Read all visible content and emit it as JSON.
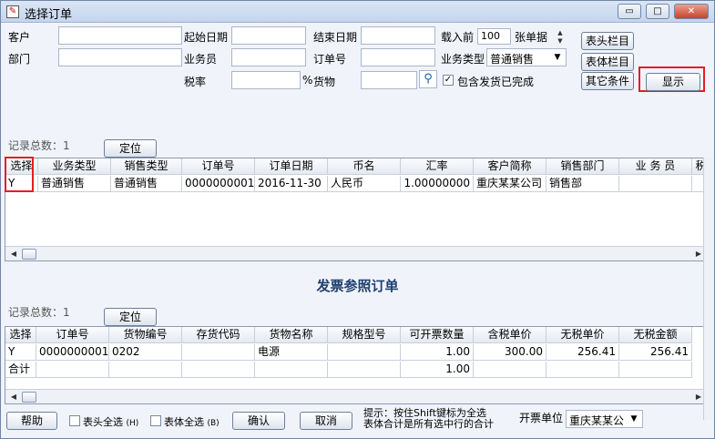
{
  "window": {
    "title": "选择订单",
    "min": "▭",
    "max": "□",
    "close": "✕"
  },
  "filters": {
    "customer_label": "客户",
    "dept_label": "部门",
    "start_date_label": "起始日期",
    "clerk_label": "业务员",
    "tax_label": "税率",
    "percent": "%",
    "end_date_label": "结束日期",
    "order_no_label": "订单号",
    "goods_label": "货物",
    "top_label": "载入前",
    "top_value": "100",
    "top_unit": "张单据",
    "biz_type_label": "业务类型",
    "biz_type_value": "普通销售",
    "include_done_label": "包含发货已完成"
  },
  "buttons": {
    "header_cols": "表头栏目",
    "body_cols": "表体栏目",
    "other_cond": "其它条件",
    "show": "显示",
    "locate": "定位",
    "locate2": "定位",
    "help": "帮助",
    "confirm": "确认",
    "cancel": "取消"
  },
  "top_grid": {
    "record_label": "记录总数：1",
    "headers": [
      "选择",
      "业务类型",
      "销售类型",
      "订单号",
      "订单日期",
      "币名",
      "汇率",
      "客户简称",
      "销售部门",
      "业 务 员",
      "税"
    ],
    "rows": [
      [
        "Y",
        "普通销售",
        "普通销售",
        "0000000001",
        "2016-11-30",
        "人民币",
        "1.00000000",
        "重庆某某公司",
        "销售部",
        "",
        ""
      ]
    ]
  },
  "section_title": "发票参照订单",
  "bottom_grid": {
    "record_label": "记录总数：1",
    "headers": [
      "选择",
      "订单号",
      "货物编号",
      "存货代码",
      "货物名称",
      "规格型号",
      "可开票数量",
      "含税单价",
      "无税单价",
      "无税金额"
    ],
    "rows": [
      [
        "Y",
        "0000000001",
        "0202",
        "",
        "电源",
        "",
        "1.00",
        "300.00",
        "256.41",
        "256.41"
      ],
      [
        "合计",
        "",
        "",
        "",
        "",
        "",
        "1.00",
        "",
        "",
        ""
      ]
    ]
  },
  "footer": {
    "select_header_all": "表头全选",
    "select_header_key": "(H)",
    "select_body_all": "表体全选",
    "select_body_key": "(B)",
    "hint_line1": "提示：按住Shift键标为全选",
    "hint_line2": "表体合计是所有选中行的合计",
    "unit_label": "开票单位",
    "unit_value": "重庆某某公"
  }
}
